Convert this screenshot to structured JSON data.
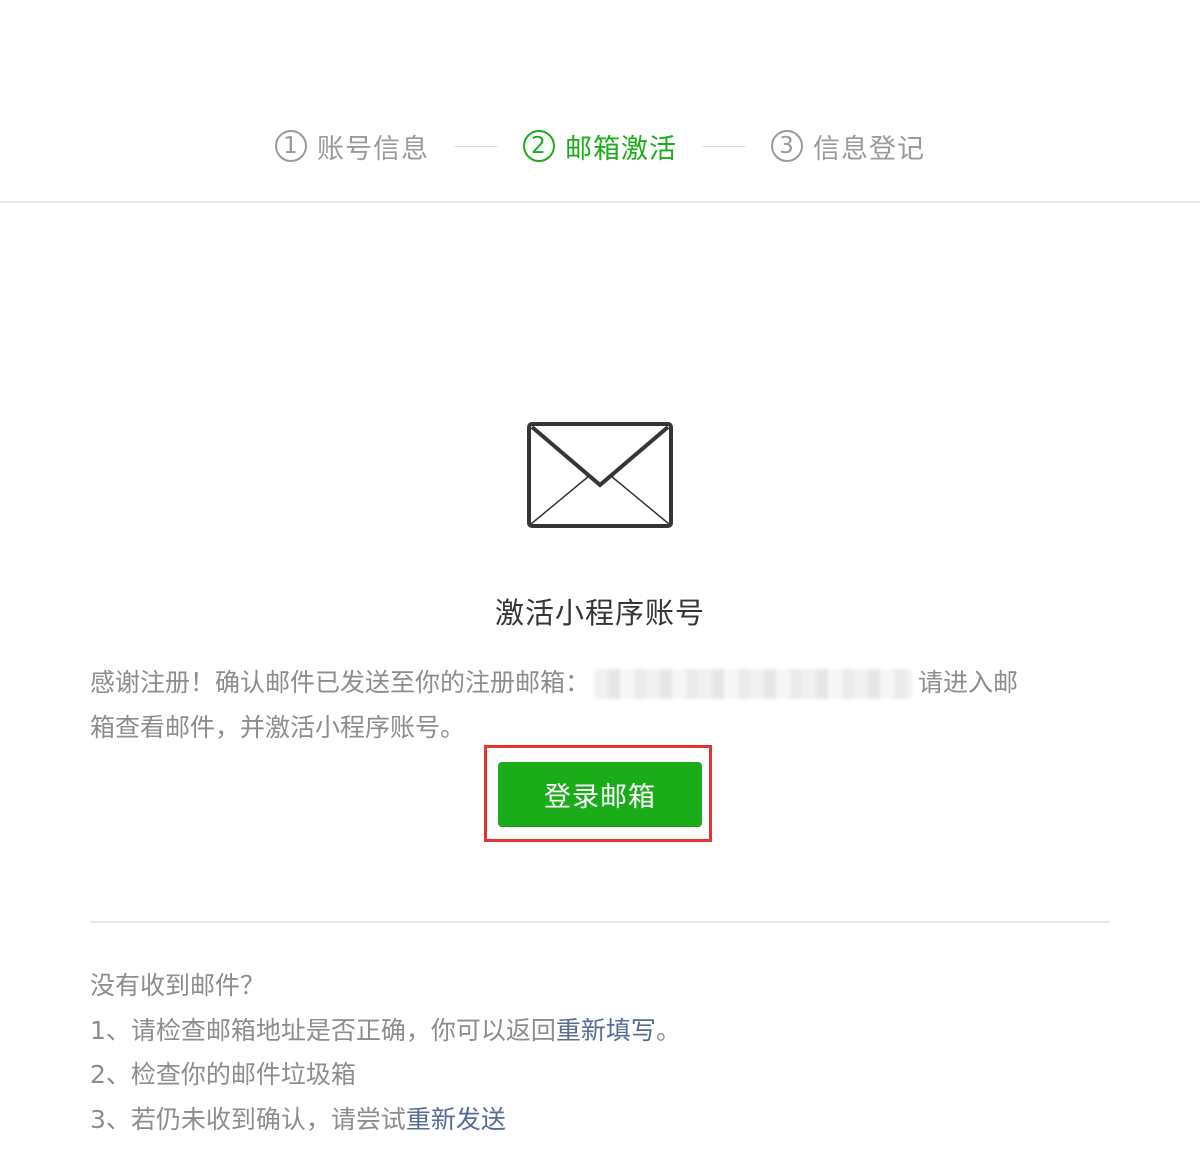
{
  "steps": [
    {
      "num": "1",
      "label": "账号信息",
      "active": false
    },
    {
      "num": "2",
      "label": "邮箱激活",
      "active": true
    },
    {
      "num": "3",
      "label": "信息登记",
      "active": false
    }
  ],
  "main": {
    "title": "激活小程序账号",
    "desc_prefix": "感谢注册！确认邮件已发送至你的注册邮箱：",
    "desc_suffix_1": "请进入邮",
    "desc_suffix_2": "箱查看邮件，并激活小程序账号。",
    "login_button": "登录邮箱"
  },
  "help": {
    "heading": "没有收到邮件？",
    "item1_text": "1、请检查邮箱地址是否正确，你可以返回",
    "item1_link": "重新填写",
    "item1_end": "。",
    "item2_text": "2、检查你的邮件垃圾箱",
    "item3_text": "3、若仍未收到确认，请尝试",
    "item3_link": "重新发送"
  },
  "colors": {
    "accent": "#1aad19",
    "link": "#576b95",
    "highlight": "#e53232"
  }
}
